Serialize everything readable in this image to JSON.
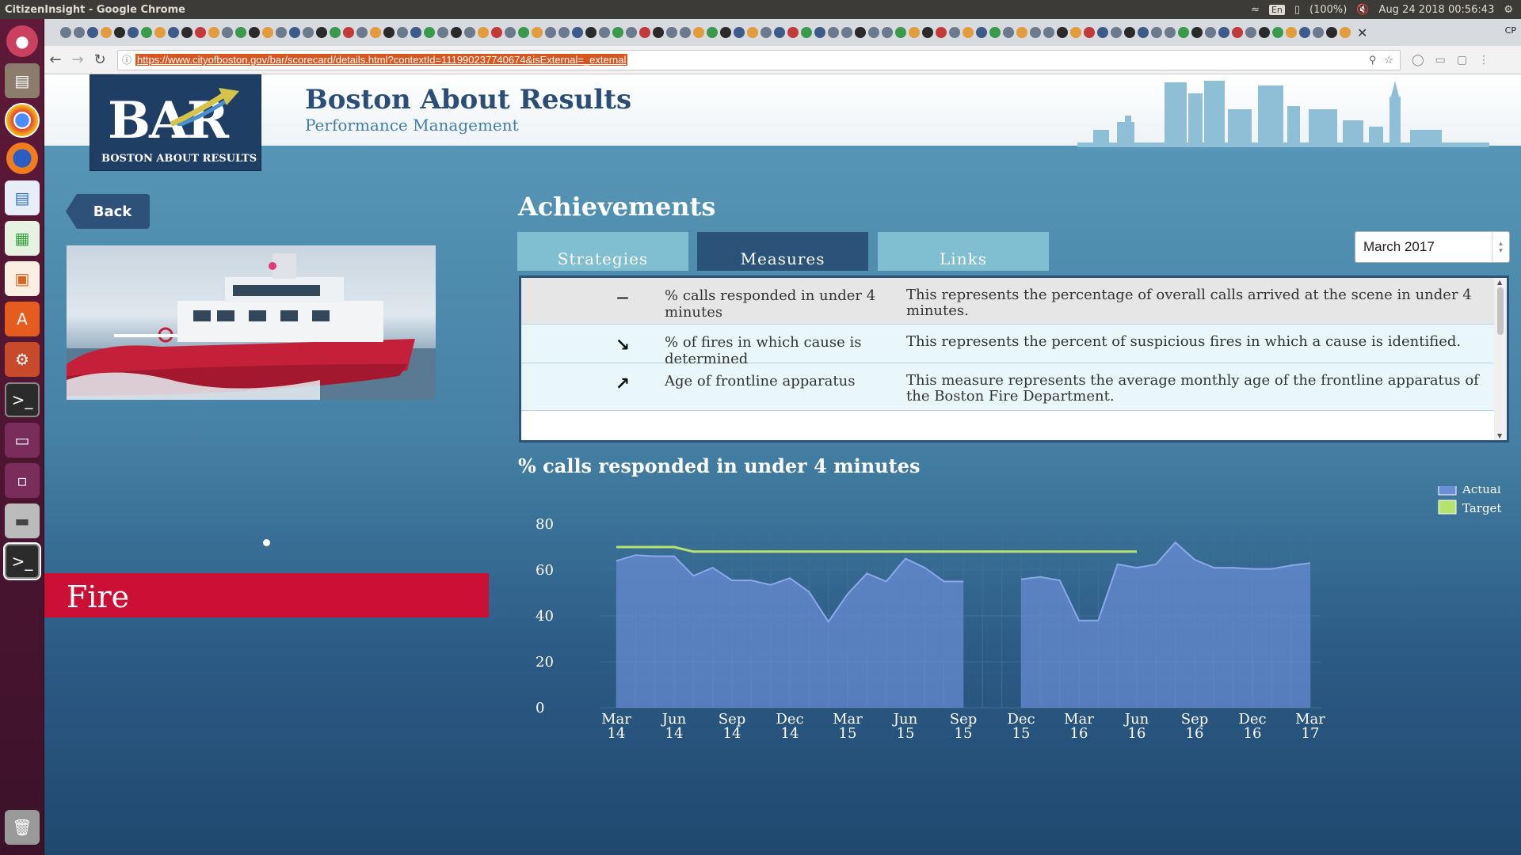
{
  "os": {
    "window_title": "CitizenInsight - Google Chrome",
    "keyboard": "En",
    "battery": "(100%)",
    "datetime": "Aug 24 2018 00:56:43"
  },
  "browser": {
    "url": "https://www.cityofboston.gov/bar/scorecard/details.html?contextId=111990237740674&isExternal=_external",
    "profile_badge": "CP"
  },
  "site": {
    "logo_big": "BAR",
    "logo_small": "BOSTON ABOUT RESULTS",
    "title": "Boston About Results",
    "subtitle": "Performance Management"
  },
  "left": {
    "back_label": "Back",
    "department": "Fire"
  },
  "main": {
    "section_title": "Achievements",
    "tabs": [
      {
        "label": "Strategies",
        "active": false
      },
      {
        "label": "Measures",
        "active": true
      },
      {
        "label": "Links",
        "active": false
      }
    ],
    "period": "March 2017",
    "measures": [
      {
        "indicator": "flat",
        "name": "% calls responded in under 4 minutes",
        "description": "This represents the percentage of overall calls arrived at the scene in under 4 minutes."
      },
      {
        "indicator": "down",
        "name": "% of fires in which cause is determined",
        "description": "This represents the percent of suspicious fires in which a cause is identified."
      },
      {
        "indicator": "up",
        "name": "Age of frontline apparatus",
        "description": "This measure represents the average monthly age of the frontline apparatus of the Boston Fire Department."
      }
    ]
  },
  "chart_data": {
    "type": "area",
    "title": "% calls responded in under 4 minutes",
    "legend": [
      "Actual",
      "Target"
    ],
    "legend_position": "top-right",
    "ylim": [
      0,
      80
    ],
    "yticks": [
      "0",
      "20",
      "40",
      "60",
      "80"
    ],
    "xticks": [
      [
        "Mar",
        "14"
      ],
      [
        "Jun",
        "14"
      ],
      [
        "Sep",
        "14"
      ],
      [
        "Dec",
        "14"
      ],
      [
        "Mar",
        "15"
      ],
      [
        "Jun",
        "15"
      ],
      [
        "Sep",
        "15"
      ],
      [
        "Dec",
        "15"
      ],
      [
        "Mar",
        "16"
      ],
      [
        "Jun",
        "16"
      ],
      [
        "Sep",
        "16"
      ],
      [
        "Dec",
        "16"
      ],
      [
        "Mar",
        "17"
      ]
    ],
    "months": [
      "Mar 14",
      "Apr 14",
      "May 14",
      "Jun 14",
      "Jul 14",
      "Aug 14",
      "Sep 14",
      "Oct 14",
      "Nov 14",
      "Dec 14",
      "Jan 15",
      "Feb 15",
      "Mar 15",
      "Apr 15",
      "May 15",
      "Jun 15",
      "Jul 15",
      "Aug 15",
      "Sep 15",
      "Oct 15",
      "Nov 15",
      "Dec 15",
      "Jan 16",
      "Feb 16",
      "Mar 16",
      "Apr 16",
      "May 16",
      "Jun 16",
      "Jul 16",
      "Aug 16",
      "Sep 16",
      "Oct 16",
      "Nov 16",
      "Dec 16",
      "Jan 17",
      "Feb 17",
      "Mar 17"
    ],
    "series": [
      {
        "name": "Actual",
        "color": "#6b8fd6",
        "values": [
          64,
          66.5,
          66,
          66,
          57.5,
          61,
          55.5,
          55.5,
          53.5,
          56.5,
          50.5,
          37.5,
          49.5,
          58.5,
          55,
          65,
          61,
          55,
          55,
          null,
          null,
          56,
          57,
          55.5,
          38,
          38,
          62.5,
          61,
          62.5,
          72,
          64.5,
          61,
          61,
          60.5,
          60.5,
          62,
          63
        ]
      },
      {
        "name": "Target",
        "color": "#b6e36e",
        "values": [
          70,
          70,
          70,
          70,
          68,
          68,
          68,
          68,
          68,
          68,
          68,
          68,
          68,
          68,
          68,
          68,
          68,
          68,
          68,
          68,
          68,
          68,
          68,
          68,
          68,
          68,
          68,
          68,
          null,
          null,
          null,
          null,
          null,
          null,
          null,
          null,
          null
        ]
      }
    ]
  }
}
